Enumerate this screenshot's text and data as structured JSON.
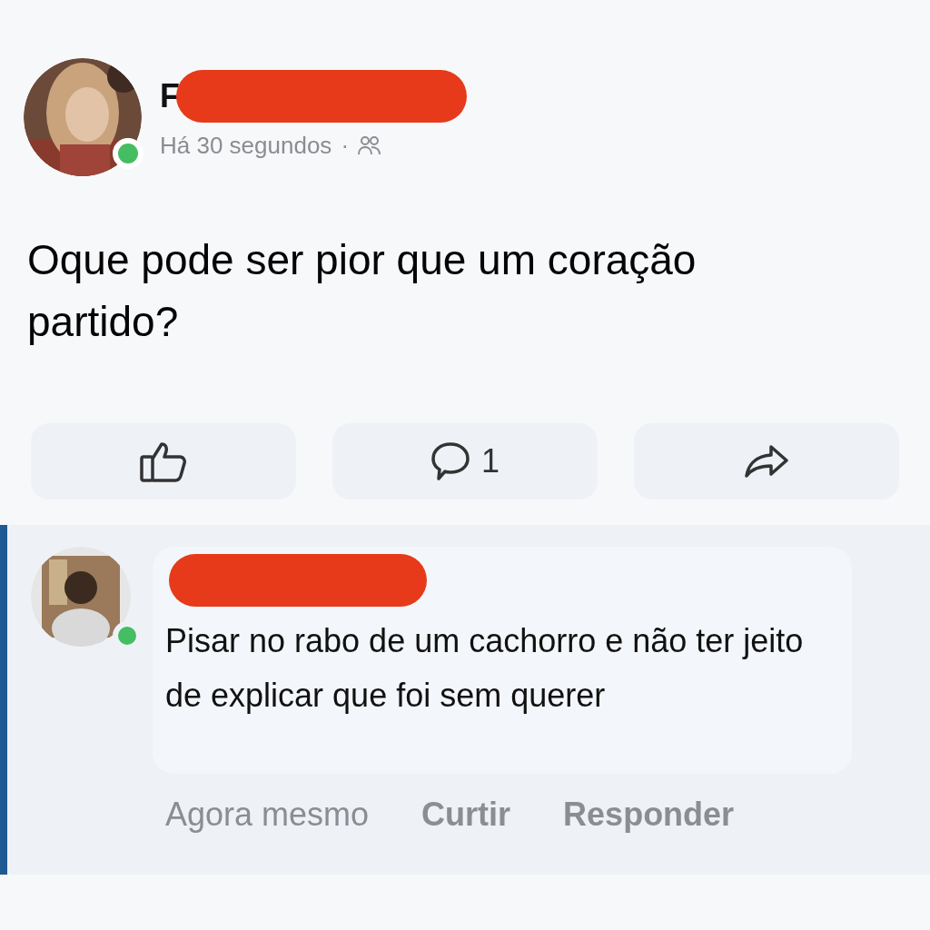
{
  "post": {
    "author": "F",
    "online": true,
    "time": "Há 30 segundos",
    "separator": "·",
    "text": "Oque pode ser pior que um coração partido?"
  },
  "actions": [
    {
      "kind": "like"
    },
    {
      "kind": "comment",
      "count": "1"
    },
    {
      "kind": "share"
    }
  ],
  "comment": {
    "online": true,
    "text": "Pisar no rabo de um cachorro e não ter jeito de explicar que foi sem querer",
    "links": [
      "Agora mesmo",
      "Curtir",
      "Responder"
    ]
  }
}
